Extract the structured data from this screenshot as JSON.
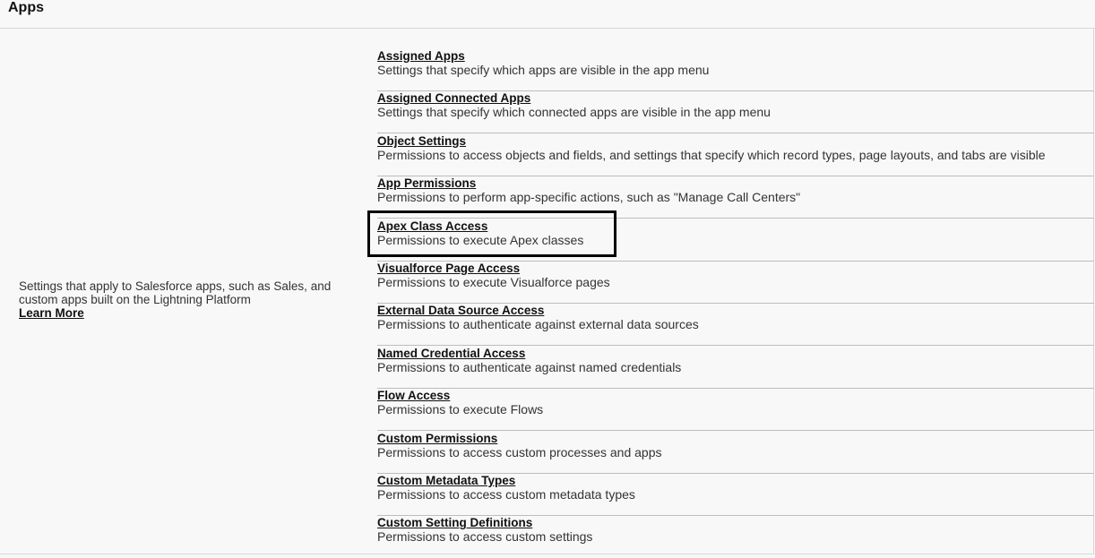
{
  "header": {
    "title": "Apps"
  },
  "left": {
    "description": "Settings that apply to Salesforce apps, such as Sales, and custom apps built on the Lightning Platform",
    "learn_more": "Learn More"
  },
  "items": [
    {
      "title": "Assigned Apps",
      "description": "Settings that specify which apps are visible in the app menu"
    },
    {
      "title": "Assigned Connected Apps",
      "description": "Settings that specify which connected apps are visible in the app menu"
    },
    {
      "title": "Object Settings",
      "description": "Permissions to access objects and fields, and settings that specify which record types, page layouts, and tabs are visible"
    },
    {
      "title": "App Permissions",
      "description": "Permissions to perform app-specific actions, such as \"Manage Call Centers\""
    },
    {
      "title": "Apex Class Access",
      "description": "Permissions to execute Apex classes",
      "highlighted": true
    },
    {
      "title": "Visualforce Page Access",
      "description": "Permissions to execute Visualforce pages"
    },
    {
      "title": "External Data Source Access",
      "description": "Permissions to authenticate against external data sources"
    },
    {
      "title": "Named Credential Access",
      "description": "Permissions to authenticate against named credentials"
    },
    {
      "title": "Flow Access",
      "description": "Permissions to execute Flows"
    },
    {
      "title": "Custom Permissions",
      "description": "Permissions to access custom processes and apps"
    },
    {
      "title": "Custom Metadata Types",
      "description": "Permissions to access custom metadata types"
    },
    {
      "title": "Custom Setting Definitions",
      "description": "Permissions to access custom settings"
    }
  ]
}
